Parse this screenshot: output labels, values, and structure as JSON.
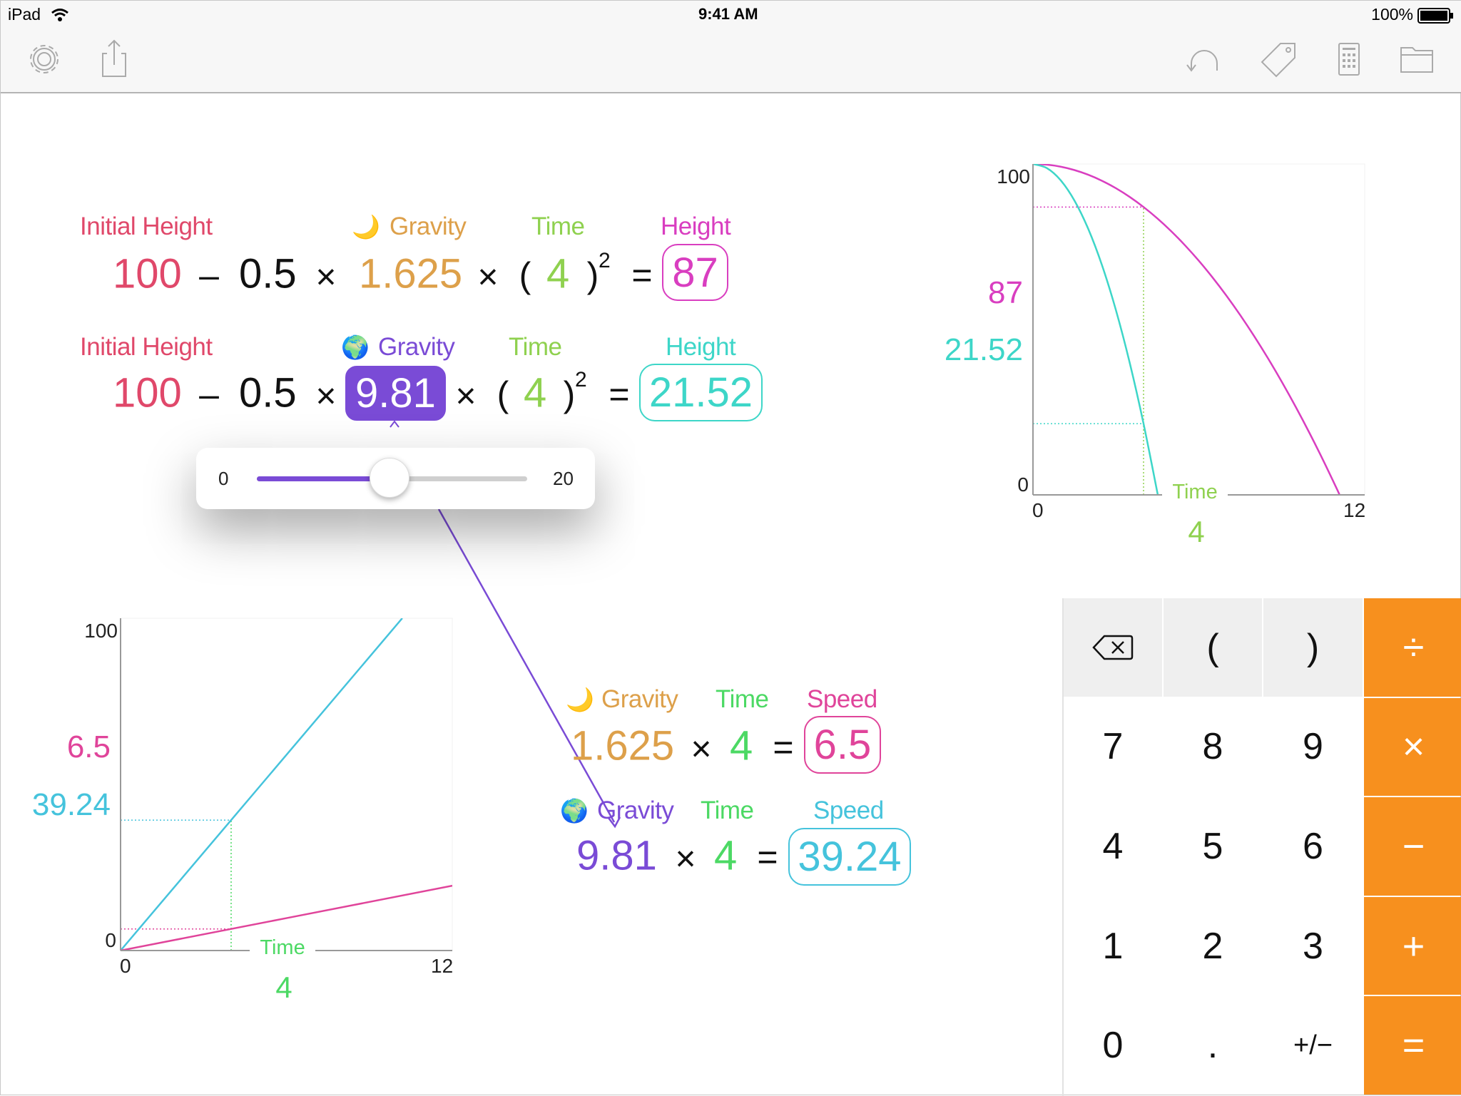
{
  "status_bar": {
    "device": "iPad",
    "time": "9:41 AM",
    "battery": "100%"
  },
  "toolbar": {
    "left_icons": [
      "gear-icon",
      "share-icon"
    ],
    "right_icons": [
      "undo-icon",
      "tag-icon",
      "calculator-icon",
      "folder-icon"
    ]
  },
  "colors": {
    "initial_height": "#e0486a",
    "moon_gravity": "#dda04a",
    "earth_gravity": "#7a4bd6",
    "time_light": "#8fd14f",
    "time_green": "#4cd964",
    "moon_height": "#d93ec0",
    "earth_height": "#3dd6c8",
    "moon_speed": "#e0449a",
    "earth_speed": "#45c3dc",
    "keypad_accent": "#f7901e"
  },
  "equations": {
    "moon_height": {
      "labels": {
        "initial_height": "Initial Height",
        "gravity_icon": "moon-icon",
        "gravity": "Gravity",
        "time": "Time",
        "result": "Height"
      },
      "initial_height": "100",
      "minus": "–",
      "half": "0.5",
      "times": "×",
      "gravity": "1.625",
      "open_paren": "(",
      "time": "4",
      "close_paren": ")",
      "exponent": "2",
      "equals": "=",
      "result": "87"
    },
    "earth_height": {
      "labels": {
        "initial_height": "Initial Height",
        "gravity_icon": "earth-icon",
        "gravity": "Gravity",
        "time": "Time",
        "result": "Height"
      },
      "initial_height": "100",
      "minus": "–",
      "half": "0.5",
      "times": "×",
      "gravity": "9.81",
      "open_paren": "(",
      "time": "4",
      "close_paren": ")",
      "exponent": "2",
      "equals": "=",
      "result": "21.52"
    },
    "moon_speed": {
      "labels": {
        "gravity_icon": "moon-icon",
        "gravity": "Gravity",
        "time": "Time",
        "result": "Speed"
      },
      "gravity": "1.625",
      "times": "×",
      "time": "4",
      "equals": "=",
      "result": "6.5"
    },
    "earth_speed": {
      "labels": {
        "gravity_icon": "earth-icon",
        "gravity": "Gravity",
        "time": "Time",
        "result": "Speed"
      },
      "gravity": "9.81",
      "times": "×",
      "time": "4",
      "equals": "=",
      "result": "39.24"
    }
  },
  "slider": {
    "min_label": "0",
    "max_label": "20",
    "min": 0,
    "max": 20,
    "value": 9.81
  },
  "keypad": {
    "rows": [
      [
        "⌫",
        "(",
        ")",
        "÷"
      ],
      [
        "7",
        "8",
        "9",
        "×"
      ],
      [
        "4",
        "5",
        "6",
        "−"
      ],
      [
        "1",
        "2",
        "3",
        "+"
      ],
      [
        "0",
        ".",
        "+/−",
        "="
      ]
    ]
  },
  "chart_data": [
    {
      "type": "line",
      "xlabel": "Time",
      "x_value_label": "4",
      "xlim": [
        0,
        12
      ],
      "ylim": [
        0,
        100
      ],
      "x_ticks": [
        "0",
        "12"
      ],
      "y_ticks": [
        "0",
        "100"
      ],
      "grid": false,
      "series": [
        {
          "color": "#d93ec0",
          "result_label": "87",
          "points": [
            [
              0,
              100
            ],
            [
              0.5,
              99.8
            ],
            [
              1,
              99.19
            ],
            [
              1.5,
              98.17
            ],
            [
              2,
              96.75
            ],
            [
              2.5,
              94.92
            ],
            [
              3,
              92.69
            ],
            [
              3.5,
              90.05
            ],
            [
              4,
              87
            ],
            [
              4.5,
              83.55
            ],
            [
              5,
              79.69
            ],
            [
              5.5,
              75.42
            ],
            [
              6,
              70.75
            ],
            [
              6.5,
              65.67
            ],
            [
              7,
              60.19
            ],
            [
              7.5,
              54.3
            ],
            [
              8,
              48
            ],
            [
              8.5,
              41.3
            ],
            [
              9,
              34.19
            ],
            [
              9.5,
              26.67
            ],
            [
              10,
              18.75
            ],
            [
              10.5,
              10.42
            ],
            [
              11,
              1.69
            ],
            [
              11.09,
              0
            ]
          ]
        },
        {
          "color": "#3dd6c8",
          "result_label": "21.52",
          "points": [
            [
              0,
              100
            ],
            [
              0.5,
              98.77
            ],
            [
              1,
              95.1
            ],
            [
              1.5,
              88.96
            ],
            [
              2,
              80.38
            ],
            [
              2.5,
              69.34
            ],
            [
              3,
              55.86
            ],
            [
              3.5,
              39.91
            ],
            [
              4,
              21.52
            ],
            [
              4.5,
              0.68
            ],
            [
              4.515,
              0
            ]
          ]
        }
      ],
      "markers": {
        "x": 4,
        "x_color": "#8fd14f",
        "y": [
          {
            "value": 87,
            "color": "#d93ec0"
          },
          {
            "value": 21.52,
            "color": "#3dd6c8"
          }
        ]
      }
    },
    {
      "type": "line",
      "xlabel": "Time",
      "x_value_label": "4",
      "xlim": [
        0,
        12
      ],
      "ylim": [
        0,
        100
      ],
      "x_ticks": [
        "0",
        "12"
      ],
      "y_ticks": [
        "0",
        "100"
      ],
      "grid": false,
      "series": [
        {
          "color": "#45c3dc",
          "result_label": "39.24",
          "points": [
            [
              0,
              0
            ],
            [
              10.19,
              100
            ]
          ]
        },
        {
          "color": "#e0449a",
          "result_label": "6.5",
          "points": [
            [
              0,
              0
            ],
            [
              12,
              19.5
            ]
          ]
        }
      ],
      "markers": {
        "x": 4,
        "x_color": "#4cd964",
        "y": [
          {
            "value": 39.24,
            "color": "#45c3dc"
          },
          {
            "value": 6.5,
            "color": "#e0449a"
          }
        ]
      }
    }
  ]
}
